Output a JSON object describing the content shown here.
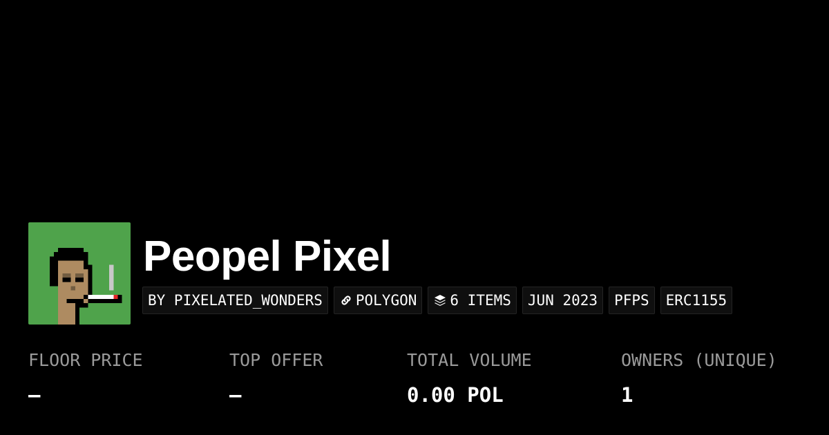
{
  "collection": {
    "name": "Peopel Pixel",
    "avatar_icon": "pixel-punk-smoking-avatar",
    "avatar_background": "#4fa34b"
  },
  "tags": [
    {
      "label": "BY PIXELATED_WONDERS",
      "icon": ""
    },
    {
      "label": "POLYGON",
      "icon": "chain-link-icon"
    },
    {
      "label": "6 ITEMS",
      "icon": "layers-icon"
    },
    {
      "label": "JUN 2023",
      "icon": ""
    },
    {
      "label": "PFPS",
      "icon": ""
    },
    {
      "label": "ERC1155",
      "icon": ""
    }
  ],
  "stats": [
    {
      "label": "FLOOR PRICE",
      "value": "–"
    },
    {
      "label": "TOP OFFER",
      "value": "–"
    },
    {
      "label": "TOTAL VOLUME",
      "value": "0.00 POL"
    },
    {
      "label": "OWNERS (UNIQUE)",
      "value": "1"
    }
  ],
  "colors": {
    "background": "#000000",
    "text_primary": "#ffffff",
    "text_secondary": "#9a9a9a",
    "tag_background": "#0f0f0f"
  }
}
